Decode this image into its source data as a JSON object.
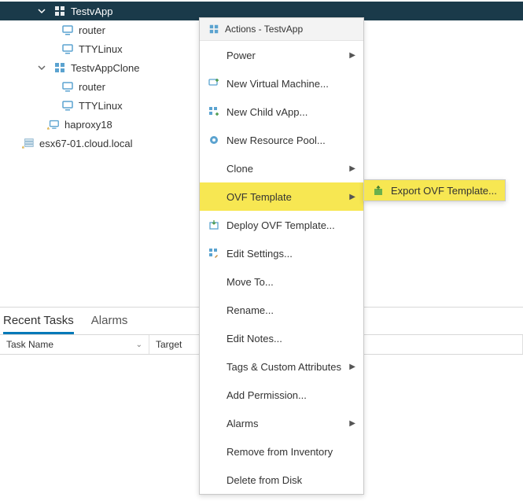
{
  "tree": {
    "root": {
      "vapp1": {
        "name": "TestvApp",
        "children": [
          "router",
          "TTYLinux"
        ]
      },
      "vapp2": {
        "name": "TestvAppClone",
        "children": [
          "router",
          "TTYLinux"
        ]
      },
      "vm1": {
        "name": "haproxy18"
      }
    },
    "host": {
      "name": "esx67-01.cloud.local"
    }
  },
  "menu": {
    "header": "Actions - TestvApp",
    "items": {
      "power": "Power",
      "newvm": "New Virtual Machine...",
      "newvapp": "New Child vApp...",
      "newpool": "New Resource Pool...",
      "clone": "Clone",
      "ovf": "OVF Template",
      "deploy": "Deploy OVF Template...",
      "edit": "Edit Settings...",
      "move": "Move To...",
      "rename": "Rename...",
      "notes": "Edit Notes...",
      "tags": "Tags & Custom Attributes",
      "perm": "Add Permission...",
      "alarms": "Alarms",
      "remove": "Remove from Inventory",
      "delete": "Delete from Disk"
    }
  },
  "submenu": {
    "export": "Export OVF Template..."
  },
  "bottom": {
    "tabs": {
      "recent": "Recent Tasks",
      "alarms": "Alarms"
    },
    "cols": {
      "task": "Task Name",
      "target": "Target"
    }
  }
}
